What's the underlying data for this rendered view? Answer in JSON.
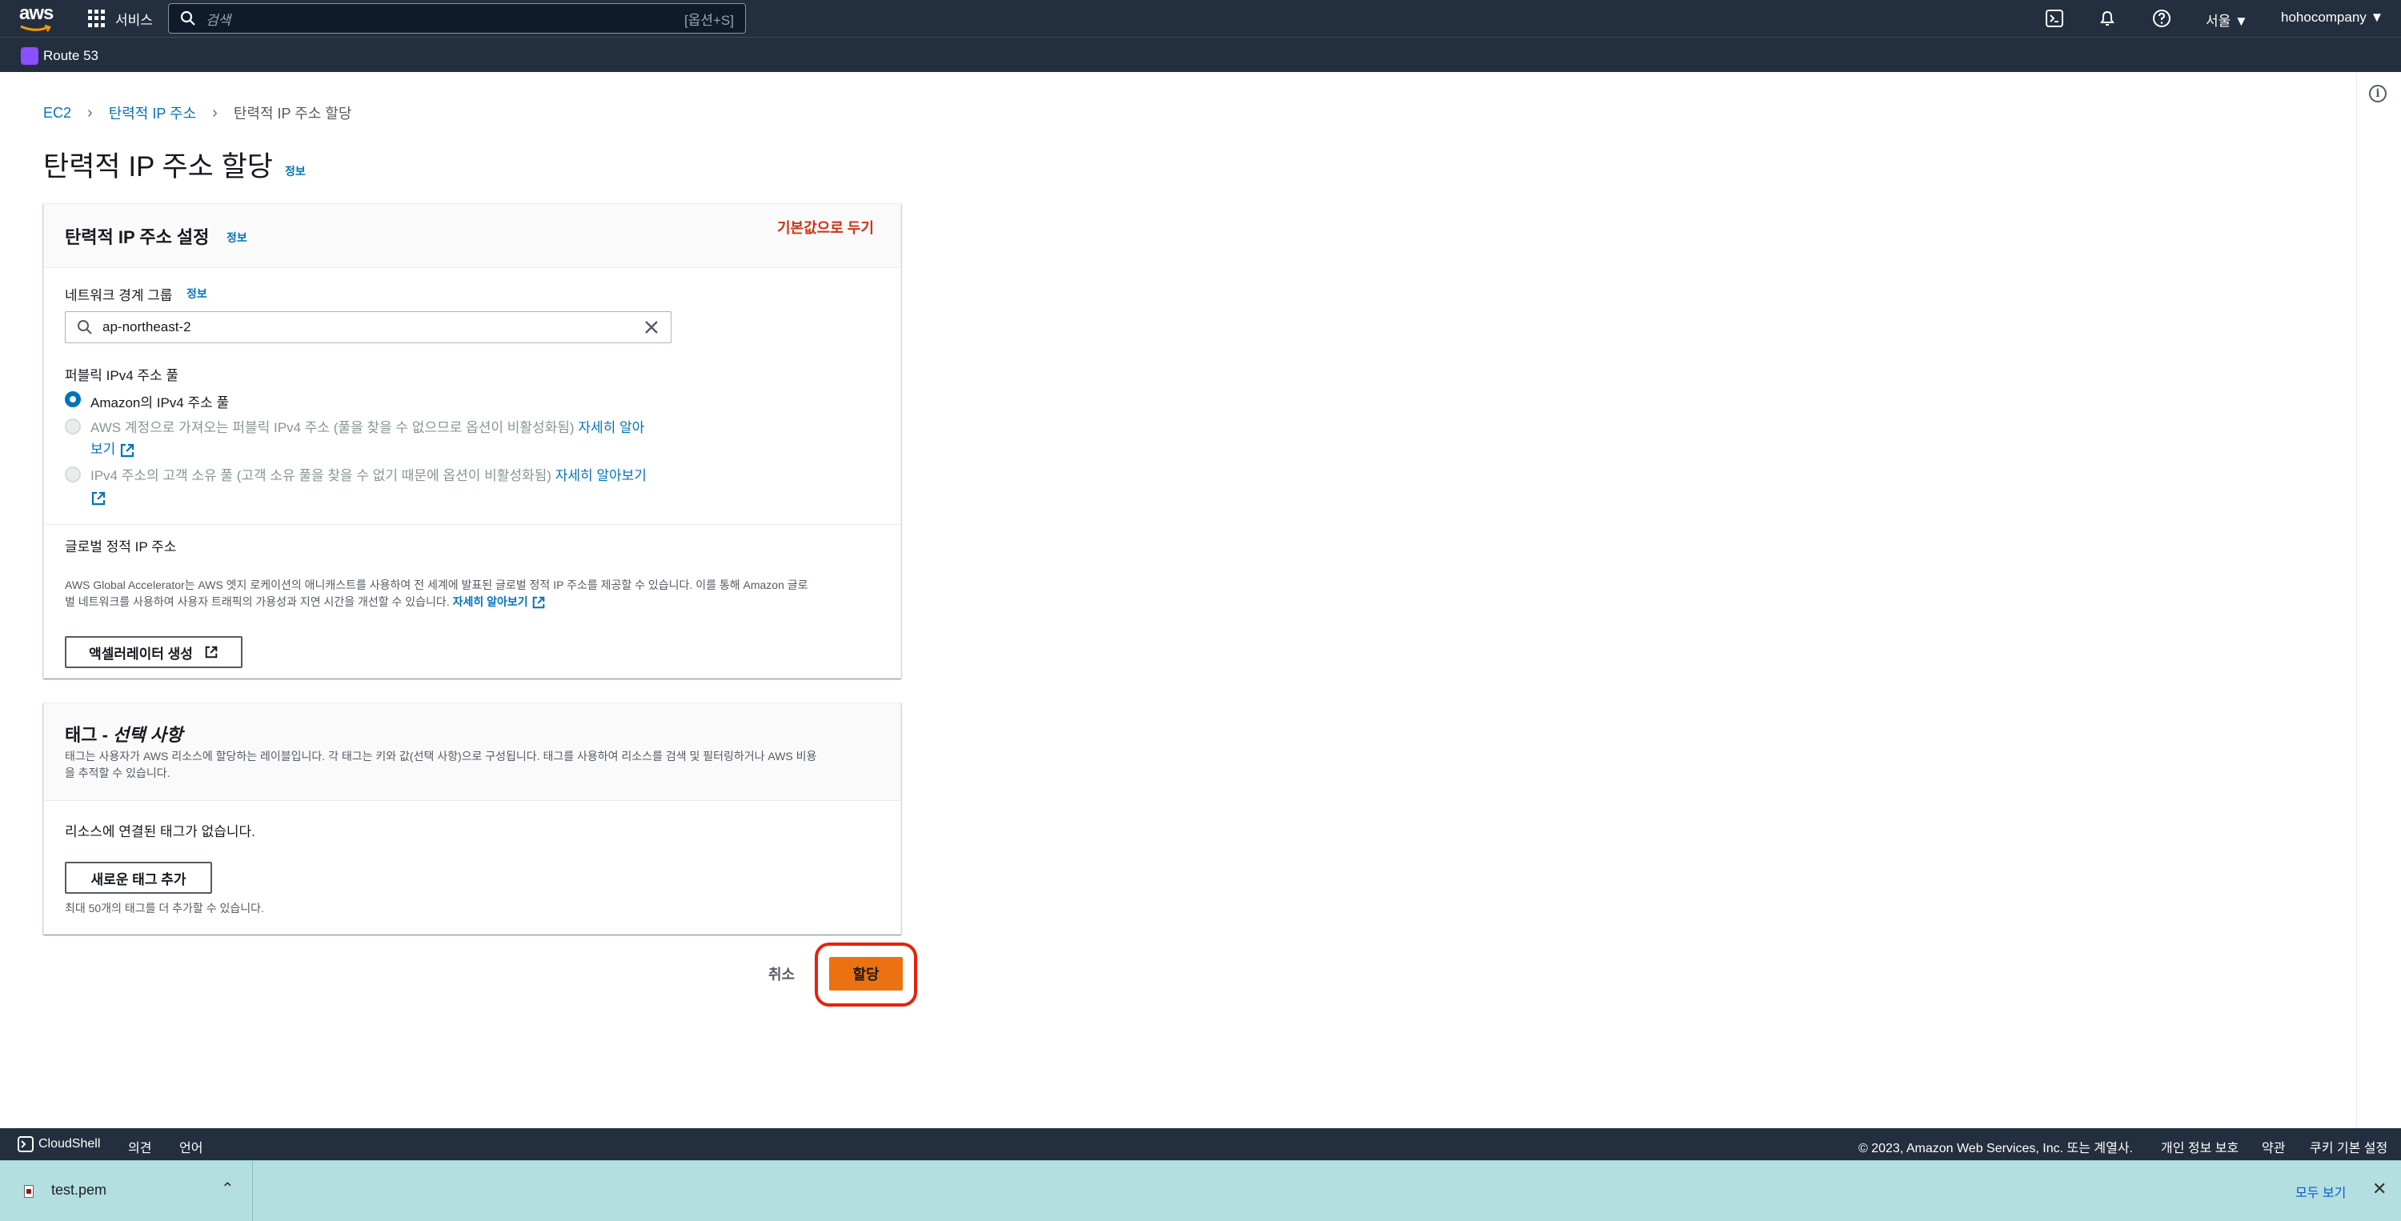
{
  "topnav": {
    "logo": "aws",
    "services": "서비스",
    "search_placeholder": "검색",
    "search_shortcut": "[옵션+S]",
    "region": "서울",
    "account": "hohocompany"
  },
  "subnav": {
    "service": "Route 53"
  },
  "breadcrumb": [
    "EC2",
    "탄력적 IP 주소",
    "탄력적 IP 주소 할당"
  ],
  "page": {
    "title": "탄력적 IP 주소 할당",
    "info": "정보"
  },
  "settings": {
    "title": "탄력적 IP 주소 설정",
    "info": "정보",
    "reset": "기본값으로 두기",
    "network_border_group_label": "네트워크 경계 그룹",
    "network_border_group_info": "정보",
    "network_border_group_value": "ap-northeast-2",
    "pool_label": "퍼블릭 IPv4 주소 풀",
    "pool_option_1": "Amazon의 IPv4 주소 풀",
    "pool_option_2_text": "AWS 계정으로 가져오는 퍼블릭 IPv4 주소 (풀을 찾을 수 없으므로 옵션이 비활성화됨)",
    "pool_option_2_link_a": "자세히 알아",
    "pool_option_2_link_b": "보기",
    "pool_option_3_text": "IPv4 주소의 고객 소유 풀 (고객 소유 풀을 찾을 수 없기 때문에 옵션이 비활성화됨)",
    "pool_option_3_link": "자세히 알아보기",
    "global_label": "글로벌 정적 IP 주소",
    "global_desc_line1": "AWS Global Accelerator는 AWS 엣지 로케이션의 애니캐스트를 사용하여 전 세계에 발표된 글로벌 정적 IP 주소를 제공할 수 있습니다. 이를 통해 Amazon 글로",
    "global_desc_line2": "벌 네트워크를 사용하여 사용자 트래픽의 가용성과 지연 시간을 개선할 수 있습니다.",
    "global_desc_link": "자세히 알아보기",
    "create_accelerator": "액셀러레이터 생성"
  },
  "tags": {
    "title_prefix": "태그 - ",
    "title_italic": "선택 사항",
    "desc_line1": "태그는 사용자가 AWS 리소스에 할당하는 레이블입니다. 각 태그는 키와 값(선택 사항)으로 구성됩니다. 태그를 사용하여 리소스를 검색 및 필터링하거나 AWS 비용",
    "desc_line2": "을 추적할 수 있습니다.",
    "empty": "리소스에 연결된 태그가 없습니다.",
    "add_button": "새로운 태그 추가",
    "limit": "최대 50개의 태그를 더 추가할 수 있습니다."
  },
  "actions": {
    "cancel": "취소",
    "allocate": "할당"
  },
  "footer": {
    "cloudshell": "CloudShell",
    "feedback": "의견",
    "language": "언어",
    "copyright": "© 2023, Amazon Web Services, Inc. 또는 계열사.",
    "privacy": "개인 정보 보호",
    "terms": "약관",
    "cookies": "쿠키 기본 설정"
  },
  "downloads": {
    "file": "test.pem",
    "show_all": "모두 보기"
  },
  "colors": {
    "nav": "#232f3e",
    "link": "#0073bb",
    "primary": "#ec7211",
    "highlight": "#e4230c",
    "reset": "#d13212"
  }
}
